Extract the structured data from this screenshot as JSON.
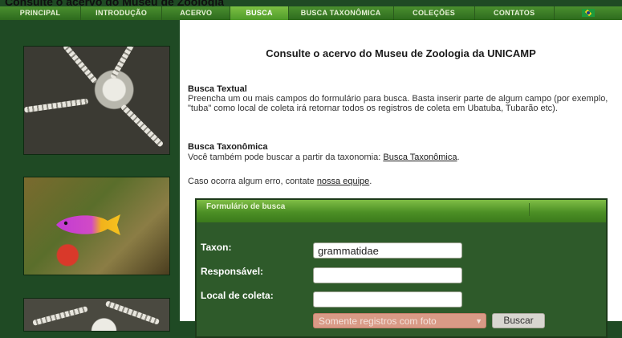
{
  "page": {
    "title": "Consulte o acervo do Museu de Zoologia"
  },
  "nav": {
    "items": [
      {
        "label": "PRINCIPAL",
        "active": false
      },
      {
        "label": "INTRODUÇÃO",
        "active": false
      },
      {
        "label": "ACERVO",
        "active": false
      },
      {
        "label": "BUSCA",
        "active": true
      },
      {
        "label": "BUSCA TAXONÔMICA",
        "active": false
      },
      {
        "label": "COLEÇÕES",
        "active": false
      },
      {
        "label": "CONTATOS",
        "active": false
      }
    ],
    "flag_icon": "brazil-flag-icon"
  },
  "sidebar": {
    "images": [
      "brittle-star-photo",
      "fish-on-reef-photo",
      "brittle-star-photo"
    ]
  },
  "main": {
    "title": "Consulte o acervo do Museu de Zoologia da UNICAMP",
    "textual": {
      "heading": "Busca Textual",
      "body": "Preencha um ou mais campos do formulário para busca. Basta inserir parte de algum campo (por exemplo, \"tuba\" como local de coleta irá retornar todos os registros de coleta em Ubatuba, Tubarão etc)."
    },
    "taxonomic": {
      "heading": "Busca Taxonômica",
      "body_prefix": "Você também pode buscar a partir da taxonomia: ",
      "link": "Busca Taxonômica",
      "body_suffix": "."
    },
    "error": {
      "prefix": "Caso ocorra algum erro, contate ",
      "link": "nossa equipe",
      "suffix": "."
    }
  },
  "form": {
    "header": "Formulário de busca",
    "taxon_label": "Taxon:",
    "taxon_value": "grammatidae",
    "responsavel_label": "Responsável:",
    "responsavel_value": "",
    "local_label": "Local de coleta:",
    "local_value": "",
    "photo_filter": "Somente registros com foto",
    "search_button": "Buscar"
  },
  "colors": {
    "nav_green": "#3f7f27",
    "nav_active": "#6cb23a",
    "sidebar_bg": "#1f4a24",
    "form_bg": "#2e5a2a",
    "select_bg": "#d99a86"
  }
}
